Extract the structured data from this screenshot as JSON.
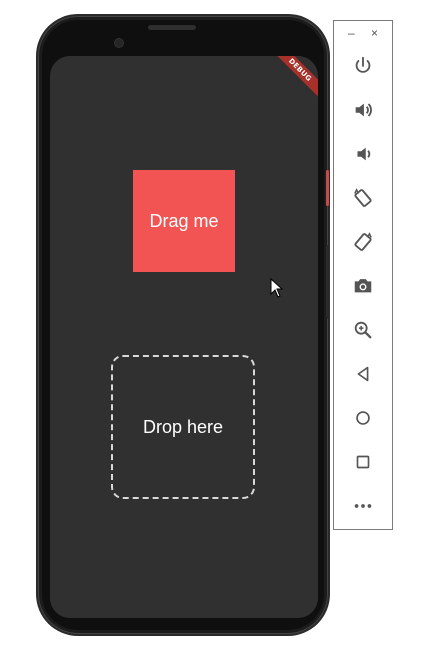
{
  "app": {
    "drag_label": "Drag me",
    "drop_label": "Drop here",
    "debug_banner": "DEBUG"
  },
  "toolbar": {
    "minimize": "–",
    "close": "×",
    "items": [
      {
        "icon": "power-icon"
      },
      {
        "icon": "volume-up-icon"
      },
      {
        "icon": "volume-down-icon"
      },
      {
        "icon": "rotate-left-icon"
      },
      {
        "icon": "rotate-right-icon"
      },
      {
        "icon": "camera-icon"
      },
      {
        "icon": "zoom-icon"
      },
      {
        "icon": "back-icon"
      },
      {
        "icon": "home-icon"
      },
      {
        "icon": "overview-icon"
      },
      {
        "icon": "more-icon"
      }
    ]
  },
  "colors": {
    "screen_bg": "#303030",
    "drag_box": "#f25454",
    "drop_border": "#d9d9d9",
    "debug_ribbon": "#a7302a"
  }
}
